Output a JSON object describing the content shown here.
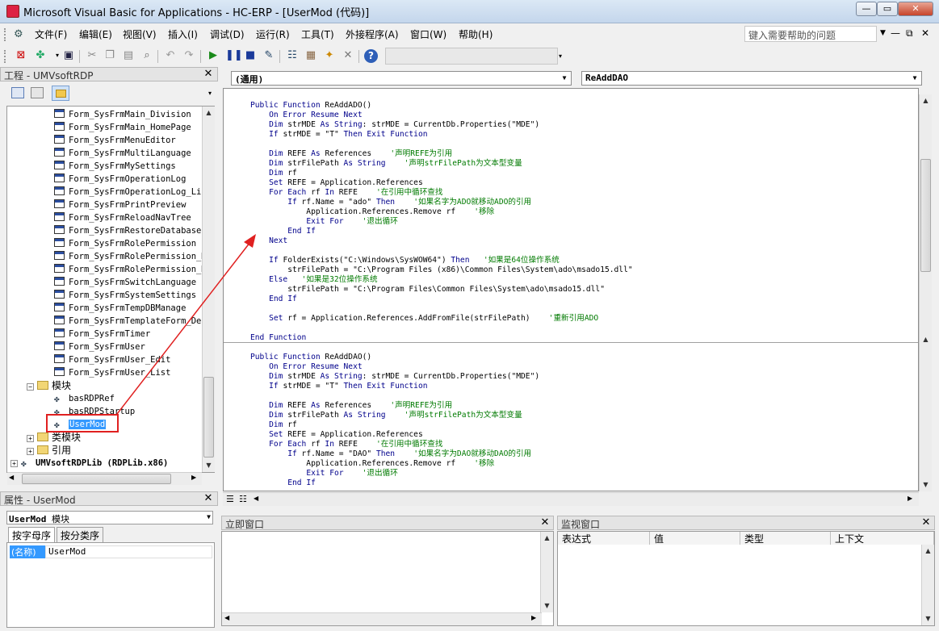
{
  "window": {
    "title": "Microsoft Visual Basic for Applications - HC-ERP - [UserMod (代码)]",
    "controls": [
      "—",
      "▭",
      "✕"
    ],
    "mdi_controls": [
      "—",
      "⧉",
      "✕"
    ]
  },
  "menu": {
    "items": [
      "文件(F)",
      "编辑(E)",
      "视图(V)",
      "插入(I)",
      "调试(D)",
      "运行(R)",
      "工具(T)",
      "外接程序(A)",
      "窗口(W)",
      "帮助(H)"
    ],
    "help_placeholder": "键入需要帮助的问题"
  },
  "project": {
    "title": "工程 - UMVsoftRDP",
    "forms": [
      "Form_SysFrmMain_Division",
      "Form_SysFrmMain_HomePage",
      "Form_SysFrmMenuEditor",
      "Form_SysFrmMultiLanguage",
      "Form_SysFrmMySettings",
      "Form_SysFrmOperationLog",
      "Form_SysFrmOperationLog_Lis",
      "Form_SysFrmPrintPreview",
      "Form_SysFrmReloadNavTree",
      "Form_SysFrmRestoreDatabase",
      "Form_SysFrmRolePermission",
      "Form_SysFrmRolePermission_M",
      "Form_SysFrmRolePermission_M",
      "Form_SysFrmSwitchLanguage",
      "Form_SysFrmSystemSettings",
      "Form_SysFrmTempDBManage",
      "Form_SysFrmTemplateForm_Def",
      "Form_SysFrmTimer",
      "Form_SysFrmUser",
      "Form_SysFrmUser_Edit",
      "Form_SysFrmUser_List"
    ],
    "modules_folder": "模块",
    "modules": [
      "basRDPRef",
      "basRDPStartup",
      "UserMod"
    ],
    "class_folder": "类模块",
    "ref_folder": "引用",
    "lib": "UMVsoftRDPLib (RDPLib.x86)"
  },
  "properties": {
    "title": "属性 - UserMod",
    "combo_name": "UserMod",
    "combo_type": "模块",
    "tabs": [
      "按字母序",
      "按分类序"
    ],
    "row_key": "(名称)",
    "row_value": "UserMod"
  },
  "code": {
    "object_combo": "(通用)",
    "proc_combo": "ReAddDAO",
    "block1": [
      [
        [
          "kw",
          "Public Function "
        ],
        [
          "t",
          "ReAddADO()"
        ]
      ],
      [
        [
          "t",
          "    "
        ],
        [
          "kw",
          "On Error Resume Next"
        ]
      ],
      [
        [
          "t",
          "    "
        ],
        [
          "kw",
          "Dim "
        ],
        [
          "t",
          "strMDE "
        ],
        [
          "kw",
          "As String"
        ],
        [
          "t",
          ": strMDE = CurrentDb.Properties(\"MDE\")"
        ]
      ],
      [
        [
          "t",
          "    "
        ],
        [
          "kw",
          "If "
        ],
        [
          "t",
          "strMDE = \"T\" "
        ],
        [
          "kw",
          "Then Exit Function"
        ]
      ],
      [
        [
          "t",
          ""
        ]
      ],
      [
        [
          "t",
          "    "
        ],
        [
          "kw",
          "Dim "
        ],
        [
          "t",
          "REFE "
        ],
        [
          "kw",
          "As "
        ],
        [
          "t",
          "References    "
        ],
        [
          "cm",
          "'声明REFE为引用"
        ]
      ],
      [
        [
          "t",
          "    "
        ],
        [
          "kw",
          "Dim "
        ],
        [
          "t",
          "strFilePath "
        ],
        [
          "kw",
          "As String"
        ],
        [
          "t",
          "    "
        ],
        [
          "cm",
          "'声明strFilePath为文本型变量"
        ]
      ],
      [
        [
          "t",
          "    "
        ],
        [
          "kw",
          "Dim "
        ],
        [
          "t",
          "rf"
        ]
      ],
      [
        [
          "t",
          "    "
        ],
        [
          "kw",
          "Set "
        ],
        [
          "t",
          "REFE = Application.References"
        ]
      ],
      [
        [
          "t",
          "    "
        ],
        [
          "kw",
          "For Each "
        ],
        [
          "t",
          "rf "
        ],
        [
          "kw",
          "In "
        ],
        [
          "t",
          "REFE    "
        ],
        [
          "cm",
          "'在引用中循环查找"
        ]
      ],
      [
        [
          "t",
          "        "
        ],
        [
          "kw",
          "If "
        ],
        [
          "t",
          "rf.Name = \"ado\" "
        ],
        [
          "kw",
          "Then"
        ],
        [
          "t",
          "    "
        ],
        [
          "cm",
          "'如果名字为ADO就移动ADO的引用"
        ]
      ],
      [
        [
          "t",
          "            Application.References.Remove rf    "
        ],
        [
          "cm",
          "'移除"
        ]
      ],
      [
        [
          "t",
          "            "
        ],
        [
          "kw",
          "Exit For"
        ],
        [
          "t",
          "    "
        ],
        [
          "cm",
          "'退出循环"
        ]
      ],
      [
        [
          "t",
          "        "
        ],
        [
          "kw",
          "End If"
        ]
      ],
      [
        [
          "t",
          "    "
        ],
        [
          "kw",
          "Next"
        ]
      ],
      [
        [
          "t",
          ""
        ]
      ],
      [
        [
          "t",
          "    "
        ],
        [
          "kw",
          "If "
        ],
        [
          "t",
          "FolderExists(\"C:\\Windows\\SysWOW64\") "
        ],
        [
          "kw",
          "Then"
        ],
        [
          "t",
          "   "
        ],
        [
          "cm",
          "'如果是64位操作系统"
        ]
      ],
      [
        [
          "t",
          "        strFilePath = \"C:\\Program Files (x86)\\Common Files\\System\\ado\\msado15.dll\""
        ]
      ],
      [
        [
          "t",
          "    "
        ],
        [
          "kw",
          "Else"
        ],
        [
          "t",
          "   "
        ],
        [
          "cm",
          "'如果是32位操作系统"
        ]
      ],
      [
        [
          "t",
          "        strFilePath = \"C:\\Program Files\\Common Files\\System\\ado\\msado15.dll\""
        ]
      ],
      [
        [
          "t",
          "    "
        ],
        [
          "kw",
          "End If"
        ]
      ],
      [
        [
          "t",
          ""
        ]
      ],
      [
        [
          "t",
          "    "
        ],
        [
          "kw",
          "Set "
        ],
        [
          "t",
          "rf = Application.References.AddFromFile(strFilePath)    "
        ],
        [
          "cm",
          "'重新引用ADO"
        ]
      ],
      [
        [
          "t",
          ""
        ]
      ],
      [
        [
          "kw",
          "End Function"
        ]
      ]
    ],
    "block2": [
      [
        [
          "kw",
          "Public Function "
        ],
        [
          "t",
          "ReAddDAO()"
        ]
      ],
      [
        [
          "t",
          "    "
        ],
        [
          "kw",
          "On Error Resume Next"
        ]
      ],
      [
        [
          "t",
          "    "
        ],
        [
          "kw",
          "Dim "
        ],
        [
          "t",
          "strMDE "
        ],
        [
          "kw",
          "As String"
        ],
        [
          "t",
          ": strMDE = CurrentDb.Properties(\"MDE\")"
        ]
      ],
      [
        [
          "t",
          "    "
        ],
        [
          "kw",
          "If "
        ],
        [
          "t",
          "strMDE = \"T\" "
        ],
        [
          "kw",
          "Then Exit Function"
        ]
      ],
      [
        [
          "t",
          ""
        ]
      ],
      [
        [
          "t",
          "    "
        ],
        [
          "kw",
          "Dim "
        ],
        [
          "t",
          "REFE "
        ],
        [
          "kw",
          "As "
        ],
        [
          "t",
          "References    "
        ],
        [
          "cm",
          "'声明REFE为引用"
        ]
      ],
      [
        [
          "t",
          "    "
        ],
        [
          "kw",
          "Dim "
        ],
        [
          "t",
          "strFilePath "
        ],
        [
          "kw",
          "As String"
        ],
        [
          "t",
          "    "
        ],
        [
          "cm",
          "'声明strFilePath为文本型变量"
        ]
      ],
      [
        [
          "t",
          "    "
        ],
        [
          "kw",
          "Dim "
        ],
        [
          "t",
          "rf"
        ]
      ],
      [
        [
          "t",
          "    "
        ],
        [
          "kw",
          "Set "
        ],
        [
          "t",
          "REFE = Application.References"
        ]
      ],
      [
        [
          "t",
          "    "
        ],
        [
          "kw",
          "For Each "
        ],
        [
          "t",
          "rf "
        ],
        [
          "kw",
          "In "
        ],
        [
          "t",
          "REFE    "
        ],
        [
          "cm",
          "'在引用中循环查找"
        ]
      ],
      [
        [
          "t",
          "        "
        ],
        [
          "kw",
          "If "
        ],
        [
          "t",
          "rf.Name = \"DAO\" "
        ],
        [
          "kw",
          "Then"
        ],
        [
          "t",
          "    "
        ],
        [
          "cm",
          "'如果名字为DAO就移动DAO的引用"
        ]
      ],
      [
        [
          "t",
          "            Application.References.Remove rf    "
        ],
        [
          "cm",
          "'移除"
        ]
      ],
      [
        [
          "t",
          "            "
        ],
        [
          "kw",
          "Exit For"
        ],
        [
          "t",
          "    "
        ],
        [
          "cm",
          "'退出循环"
        ]
      ],
      [
        [
          "t",
          "        "
        ],
        [
          "kw",
          "End If"
        ]
      ]
    ]
  },
  "immediate": {
    "title": "立即窗口"
  },
  "watch": {
    "title": "监视窗口",
    "columns": [
      "表达式",
      "值",
      "类型",
      "上下文"
    ]
  },
  "colors": {
    "keyword": "#00008b",
    "comment": "#007a00",
    "highlight": "#3399ff",
    "annotation": "#e02020"
  }
}
